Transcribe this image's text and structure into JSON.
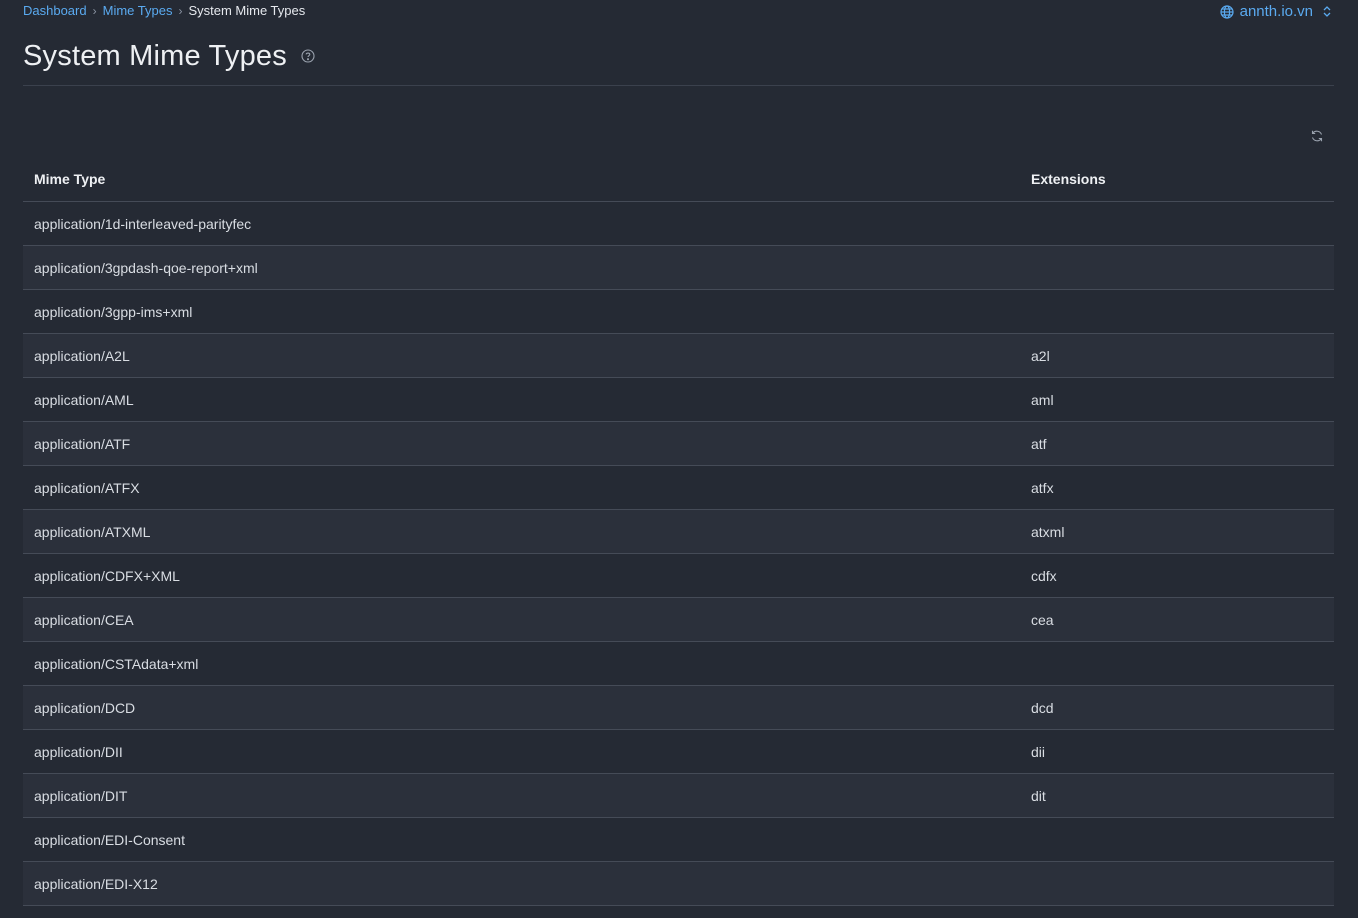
{
  "breadcrumb": {
    "items": [
      "Dashboard",
      "Mime Types"
    ],
    "current": "System Mime Types"
  },
  "site_switcher": {
    "label": "annth.io.vn",
    "icon": "globe-icon",
    "chevron_icon": "chevron-up-down-icon"
  },
  "page": {
    "title": "System Mime Types",
    "help_icon": "help-circle-icon",
    "refresh_icon": "refresh-icon"
  },
  "table": {
    "columns": [
      "Mime Type",
      "Extensions"
    ],
    "rows": [
      {
        "mime": "application/1d-interleaved-parityfec",
        "ext": ""
      },
      {
        "mime": "application/3gpdash-qoe-report+xml",
        "ext": ""
      },
      {
        "mime": "application/3gpp-ims+xml",
        "ext": ""
      },
      {
        "mime": "application/A2L",
        "ext": "a2l"
      },
      {
        "mime": "application/AML",
        "ext": "aml"
      },
      {
        "mime": "application/ATF",
        "ext": "atf"
      },
      {
        "mime": "application/ATFX",
        "ext": "atfx"
      },
      {
        "mime": "application/ATXML",
        "ext": "atxml"
      },
      {
        "mime": "application/CDFX+XML",
        "ext": "cdfx"
      },
      {
        "mime": "application/CEA",
        "ext": "cea"
      },
      {
        "mime": "application/CSTAdata+xml",
        "ext": ""
      },
      {
        "mime": "application/DCD",
        "ext": "dcd"
      },
      {
        "mime": "application/DII",
        "ext": "dii"
      },
      {
        "mime": "application/DIT",
        "ext": "dit"
      },
      {
        "mime": "application/EDI-Consent",
        "ext": ""
      },
      {
        "mime": "application/EDI-X12",
        "ext": ""
      }
    ]
  },
  "colors": {
    "background": "#252a34",
    "row_alt": "#2b303b",
    "accent": "#5aaaf0",
    "border": "#454b57"
  }
}
